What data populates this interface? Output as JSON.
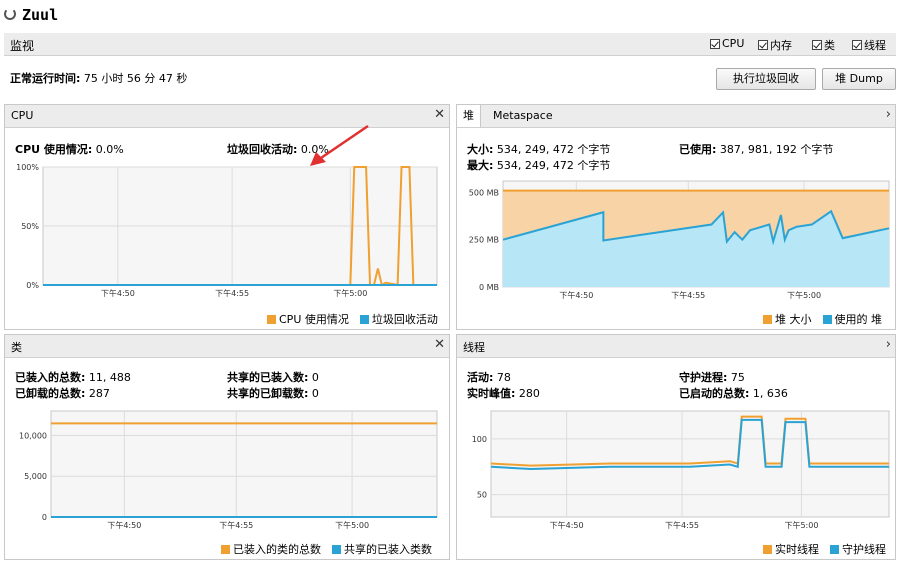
{
  "app": {
    "title": "Zuul"
  },
  "monitor": {
    "label": "监视",
    "checkboxes": [
      {
        "label": "CPU",
        "checked": true
      },
      {
        "label": "内存",
        "checked": true
      },
      {
        "label": "类",
        "checked": true
      },
      {
        "label": "线程",
        "checked": true
      }
    ],
    "uptime_label": "正常运行时间:",
    "uptime_value": "75 小时 56 分 47 秒",
    "gc_button": "执行垃圾回收",
    "heap_dump_button": "堆 Dump"
  },
  "cpu": {
    "title": "CPU",
    "usage_label": "CPU 使用情况:",
    "usage_value": "0.0%",
    "gc_label": "垃圾回收活动:",
    "gc_value": "0.0%",
    "legend": [
      "CPU 使用情况",
      "垃圾回收活动"
    ]
  },
  "heap": {
    "tabs": [
      "堆",
      "Metaspace"
    ],
    "size_label": "大小:",
    "size_value": "534, 249, 472 个字节",
    "max_label": "最大:",
    "max_value": "534, 249, 472 个字节",
    "used_label": "已使用:",
    "used_value": "387, 981, 192 个字节",
    "legend": [
      "堆 大小",
      "使用的 堆"
    ]
  },
  "classes": {
    "title": "类",
    "loaded_label": "已装入的总数:",
    "loaded_value": "11, 488",
    "unloaded_label": "已卸载的总数:",
    "unloaded_value": "287",
    "shared_loaded_label": "共享的已装入数:",
    "shared_loaded_value": "0",
    "shared_unloaded_label": "共享的已卸载数:",
    "shared_unloaded_value": "0",
    "legend": [
      "已装入的类的总数",
      "共享的已装入类数"
    ]
  },
  "threads": {
    "title": "线程",
    "live_label": "活动:",
    "live_value": "78",
    "peak_label": "实时峰值:",
    "peak_value": "280",
    "daemon_label": "守护进程:",
    "daemon_value": "75",
    "started_label": "已启动的总数:",
    "started_value": "1, 636",
    "legend": [
      "实时线程",
      "守护线程"
    ]
  },
  "colors": {
    "orange": "#f0a030",
    "blue": "#2aa3d4",
    "heap_fill": "#f7d3a6",
    "used_fill": "#b7e6f6"
  },
  "chart_data": [
    {
      "type": "line",
      "name": "CPU",
      "x_ticks": [
        "下午4:50",
        "下午4:55",
        "下午5:00"
      ],
      "y_ticks": [
        "0%",
        "50%",
        "100%"
      ],
      "ylim": [
        0,
        100
      ],
      "series": [
        {
          "name": "CPU 使用情况",
          "x": [
            0,
            0.78,
            0.79,
            0.8,
            0.81,
            0.82,
            0.83,
            0.84,
            0.85,
            0.86,
            0.87,
            0.9,
            0.91,
            0.92,
            0.93,
            0.94,
            0.95,
            1.0
          ],
          "values": [
            0,
            0,
            100,
            100,
            100,
            100,
            0,
            0,
            14,
            0,
            2,
            0,
            100,
            100,
            100,
            0,
            0,
            0
          ]
        },
        {
          "name": "垃圾回收活动",
          "x": [
            0,
            1.0
          ],
          "values": [
            0,
            0
          ]
        }
      ]
    },
    {
      "type": "area",
      "name": "堆",
      "x_ticks": [
        "下午4:50",
        "下午4:55",
        "下午5:00"
      ],
      "y_ticks": [
        "0 MB",
        "250 MB",
        "500 MB"
      ],
      "ylim": [
        0,
        560
      ],
      "series": [
        {
          "name": "堆 大小",
          "x": [
            0,
            1.0
          ],
          "values": [
            509,
            509
          ]
        },
        {
          "name": "使用的 堆",
          "x": [
            0,
            0.26,
            0.26,
            0.54,
            0.57,
            0.58,
            0.6,
            0.62,
            0.64,
            0.69,
            0.7,
            0.72,
            0.73,
            0.74,
            0.76,
            0.8,
            0.85,
            0.88,
            1.0
          ],
          "values": [
            250,
            395,
            246,
            330,
            394,
            240,
            290,
            250,
            300,
            330,
            240,
            380,
            250,
            300,
            318,
            330,
            400,
            258,
            310
          ]
        }
      ]
    },
    {
      "type": "line",
      "name": "类",
      "x_ticks": [
        "下午4:50",
        "下午4:55",
        "下午5:00"
      ],
      "y_ticks": [
        "0",
        "5,000",
        "10,000"
      ],
      "ylim": [
        0,
        13000
      ],
      "series": [
        {
          "name": "已装入的类的总数",
          "x": [
            0,
            1.0
          ],
          "values": [
            11488,
            11488
          ]
        },
        {
          "name": "共享的已装入类数",
          "x": [
            0,
            1.0
          ],
          "values": [
            0,
            0
          ]
        }
      ]
    },
    {
      "type": "line",
      "name": "线程",
      "x_ticks": [
        "下午4:50",
        "下午4:55",
        "下午5:00"
      ],
      "y_ticks": [
        "50",
        "100"
      ],
      "ylim": [
        30,
        125
      ],
      "series": [
        {
          "name": "实时线程",
          "x": [
            0,
            0.1,
            0.3,
            0.5,
            0.6,
            0.62,
            0.63,
            0.68,
            0.69,
            0.73,
            0.74,
            0.79,
            0.8,
            1.0
          ],
          "values": [
            78,
            76,
            78,
            78,
            80,
            78,
            120,
            120,
            78,
            78,
            118,
            118,
            78,
            78
          ]
        },
        {
          "name": "守护线程",
          "x": [
            0,
            0.1,
            0.3,
            0.5,
            0.6,
            0.62,
            0.63,
            0.68,
            0.69,
            0.73,
            0.74,
            0.79,
            0.8,
            1.0
          ],
          "values": [
            75,
            73,
            75,
            75,
            77,
            75,
            117,
            117,
            75,
            75,
            115,
            115,
            75,
            75
          ]
        }
      ]
    }
  ]
}
